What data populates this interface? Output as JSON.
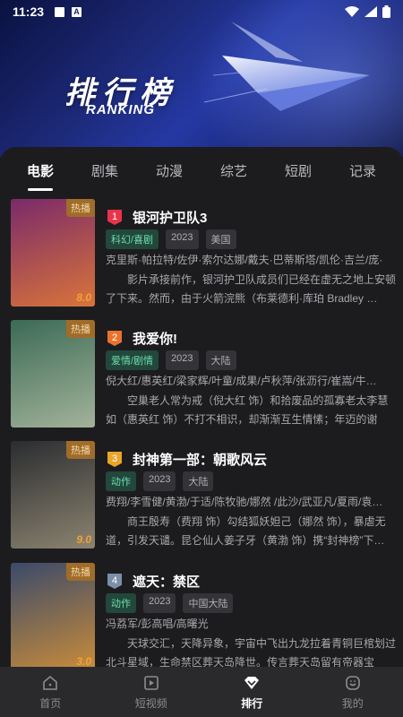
{
  "status": {
    "time": "11:23"
  },
  "header": {
    "title_cn": "排行榜",
    "title_en": "RANKING"
  },
  "tabs": [
    {
      "label": "电影",
      "active": true
    },
    {
      "label": "剧集"
    },
    {
      "label": "动漫"
    },
    {
      "label": "综艺"
    },
    {
      "label": "短剧"
    },
    {
      "label": "记录"
    }
  ],
  "items": [
    {
      "rank": "1",
      "rank_color": "#e8344a",
      "title": "银河护卫队3",
      "genre": "科幻/喜剧",
      "year": "2023",
      "region": "美国",
      "cast": "克里斯·帕拉特/佐伊·索尔达娜/戴夫·巴蒂斯塔/凯伦·吉兰/庞·",
      "desc": "影片承接前作，银河护卫队成员们已经在虚无之地上安顿了下来。然而，由于火箭浣熊（布莱德利·库珀 Bradley …",
      "hot": "热播",
      "score": "8.0",
      "poster_colors": [
        "#7a2a6a",
        "#d9743a"
      ]
    },
    {
      "rank": "2",
      "rank_color": "#e8732e",
      "title": "我爱你!",
      "genre": "爱情/剧情",
      "year": "2023",
      "region": "大陆",
      "cast": "倪大红/惠英红/梁家辉/叶童/成果/卢秋萍/张沥行/崔嵩/牛…",
      "desc": "空巢老人常为戒（倪大红 饰）和拾废品的孤寡老太李慧如（惠英红 饰）不打不相识，却渐渐互生情愫；年迈的谢定…",
      "hot": "热播",
      "score": "",
      "poster_colors": [
        "#3b6a55",
        "#a3b39a"
      ]
    },
    {
      "rank": "3",
      "rank_color": "#e8a62a",
      "title": "封神第一部：朝歌风云",
      "genre": "动作",
      "year": "2023",
      "region": "大陆",
      "cast": "费翔/李雪健/黄渤/于适/陈牧驰/娜然 /此沙/武亚凡/夏雨/袁…",
      "desc": "商王殷寿（费翔 饰）勾结狐妖妲己（娜然 饰），暴虐无道，引发天谴。昆仑仙人姜子牙（黄渤 饰）携“封神榜”下…",
      "hot": "热播",
      "score": "9.0",
      "poster_colors": [
        "#2a2c30",
        "#8c8470"
      ]
    },
    {
      "rank": "4",
      "rank_color": "#7b8fa8",
      "title": "遮天：禁区",
      "genre": "动作",
      "year": "2023",
      "region": "中国大陆",
      "cast": "冯荔军/彭高唱/高曙光",
      "desc": "天球交汇，天降异象，宇宙中飞出九龙拉着青铜巨棺划过北斗星域，生命禁区葬天岛降世。传言葬天岛留有帝器宝藏，…",
      "hot": "热播",
      "score": "3.0",
      "poster_colors": [
        "#3a4a6a",
        "#c98c3a"
      ]
    }
  ],
  "nav": [
    {
      "label": "首页",
      "icon": "home-icon"
    },
    {
      "label": "短视频",
      "icon": "play-icon"
    },
    {
      "label": "排行",
      "icon": "diamond-icon",
      "active": true
    },
    {
      "label": "我的",
      "icon": "user-icon"
    }
  ]
}
